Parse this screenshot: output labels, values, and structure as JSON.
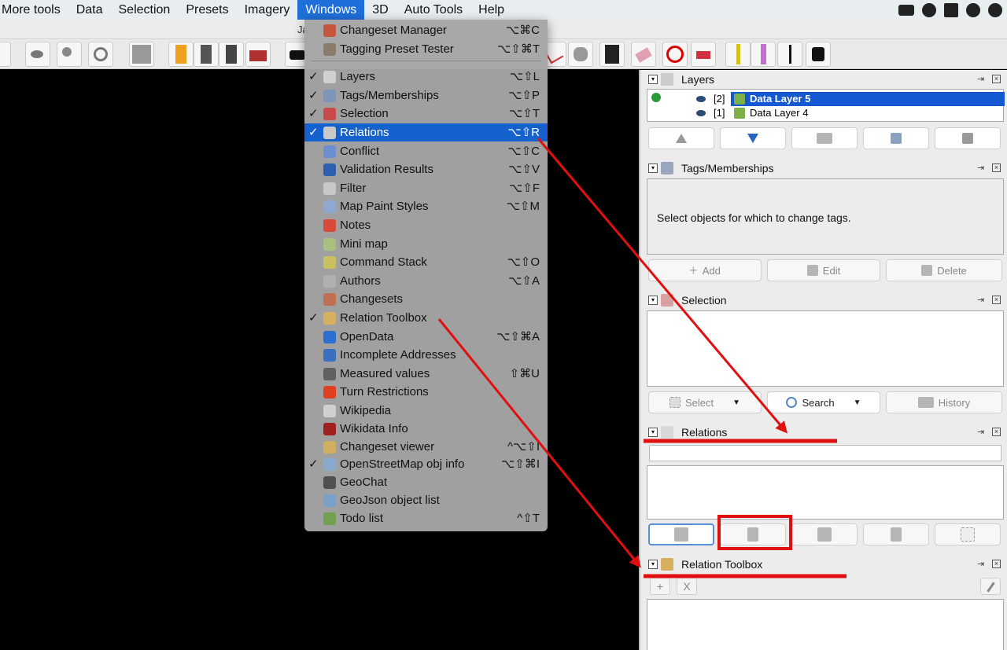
{
  "menubar": {
    "items": [
      "More tools",
      "Data",
      "Selection",
      "Presets",
      "Imagery",
      "Windows",
      "3D",
      "Auto Tools",
      "Help"
    ],
    "active": "Windows"
  },
  "window_title_fragment": "Ja",
  "windows_menu": {
    "items": [
      {
        "label": "Changeset Manager",
        "shortcut": "⌥⌘C",
        "checked": false,
        "icon_color": "#c8553d"
      },
      {
        "label": "Tagging Preset Tester",
        "shortcut": "⌥⇧⌘T",
        "checked": false,
        "icon_color": "#8b7d6b"
      },
      {
        "label": "Layers",
        "shortcut": "⌥⇧L",
        "checked": true,
        "icon_color": "#d0d0d0"
      },
      {
        "label": "Tags/Memberships",
        "shortcut": "⌥⇧P",
        "checked": true,
        "icon_color": "#7f95b8"
      },
      {
        "label": "Selection",
        "shortcut": "⌥⇧T",
        "checked": true,
        "icon_color": "#c94a4a"
      },
      {
        "label": "Relations",
        "shortcut": "⌥⇧R",
        "checked": true,
        "icon_color": "#c9c9c9"
      },
      {
        "label": "Conflict",
        "shortcut": "⌥⇧C",
        "checked": false,
        "icon_color": "#6c8fd0"
      },
      {
        "label": "Validation Results",
        "shortcut": "⌥⇧V",
        "checked": false,
        "icon_color": "#2f5fb0"
      },
      {
        "label": "Filter",
        "shortcut": "⌥⇧F",
        "checked": false,
        "icon_color": "#c8c8c8"
      },
      {
        "label": "Map Paint Styles",
        "shortcut": "⌥⇧M",
        "checked": false,
        "icon_color": "#8fa8d0"
      },
      {
        "label": "Notes",
        "shortcut": "",
        "checked": false,
        "icon_color": "#d84a3a"
      },
      {
        "label": "Mini map",
        "shortcut": "",
        "checked": false,
        "icon_color": "#a8c080"
      },
      {
        "label": "Command Stack",
        "shortcut": "⌥⇧O",
        "checked": false,
        "icon_color": "#c9c060"
      },
      {
        "label": "Authors",
        "shortcut": "⌥⇧A",
        "checked": false,
        "icon_color": "#b0b0b0"
      },
      {
        "label": "Changesets",
        "shortcut": "",
        "checked": false,
        "icon_color": "#c07050"
      },
      {
        "label": "Relation Toolbox",
        "shortcut": "",
        "checked": true,
        "icon_color": "#d4b060"
      },
      {
        "label": "OpenData",
        "shortcut": "⌥⇧⌘A",
        "checked": false,
        "icon_color": "#2d6fd0"
      },
      {
        "label": "Incomplete Addresses",
        "shortcut": "",
        "checked": false,
        "icon_color": "#3a70c0"
      },
      {
        "label": "Measured values",
        "shortcut": "⇧⌘U",
        "checked": false,
        "icon_color": "#606060"
      },
      {
        "label": "Turn Restrictions",
        "shortcut": "",
        "checked": false,
        "icon_color": "#e04020"
      },
      {
        "label": "Wikipedia",
        "shortcut": "",
        "checked": false,
        "icon_color": "#d0d0d0"
      },
      {
        "label": "Wikidata Info",
        "shortcut": "",
        "checked": false,
        "icon_color": "#a02020"
      },
      {
        "label": "Changeset viewer",
        "shortcut": "^⌥⇧I",
        "checked": false,
        "icon_color": "#d0b060"
      },
      {
        "label": "OpenStreetMap obj info",
        "shortcut": "⌥⇧⌘I",
        "checked": true,
        "icon_color": "#88aacc"
      },
      {
        "label": "GeoChat",
        "shortcut": "",
        "checked": false,
        "icon_color": "#505050"
      },
      {
        "label": "GeoJson object list",
        "shortcut": "",
        "checked": false,
        "icon_color": "#7aa0c8"
      },
      {
        "label": "Todo list",
        "shortcut": "^⇧T",
        "checked": false,
        "icon_color": "#70a050"
      }
    ],
    "highlighted": "Relations",
    "check_mark": "✓"
  },
  "layers_dialog": {
    "title": "Layers",
    "rows": [
      {
        "index": "[2]",
        "name": "Data Layer 5",
        "active": true
      },
      {
        "index": "[1]",
        "name": "Data Layer 4",
        "active": false
      }
    ],
    "buttons": [
      "move-up",
      "move-down",
      "merge",
      "toggle-visibility",
      "delete"
    ]
  },
  "tags_dialog": {
    "title": "Tags/Memberships",
    "message": "Select objects for which to change tags.",
    "buttons": {
      "add": "Add",
      "edit": "Edit",
      "delete": "Delete"
    }
  },
  "selection_dialog": {
    "title": "Selection",
    "buttons": {
      "select": "Select",
      "search": "Search",
      "history": "History"
    }
  },
  "relations_dialog": {
    "title": "Relations",
    "filter_value": ""
  },
  "relation_toolbox_dialog": {
    "title": "Relation Toolbox",
    "buttons": {
      "add": "+",
      "remove": "X"
    }
  },
  "pin_glyph": "⇥",
  "close_glyph": "×",
  "toggle_glyph": "▾",
  "annotation_color": "#e01010"
}
